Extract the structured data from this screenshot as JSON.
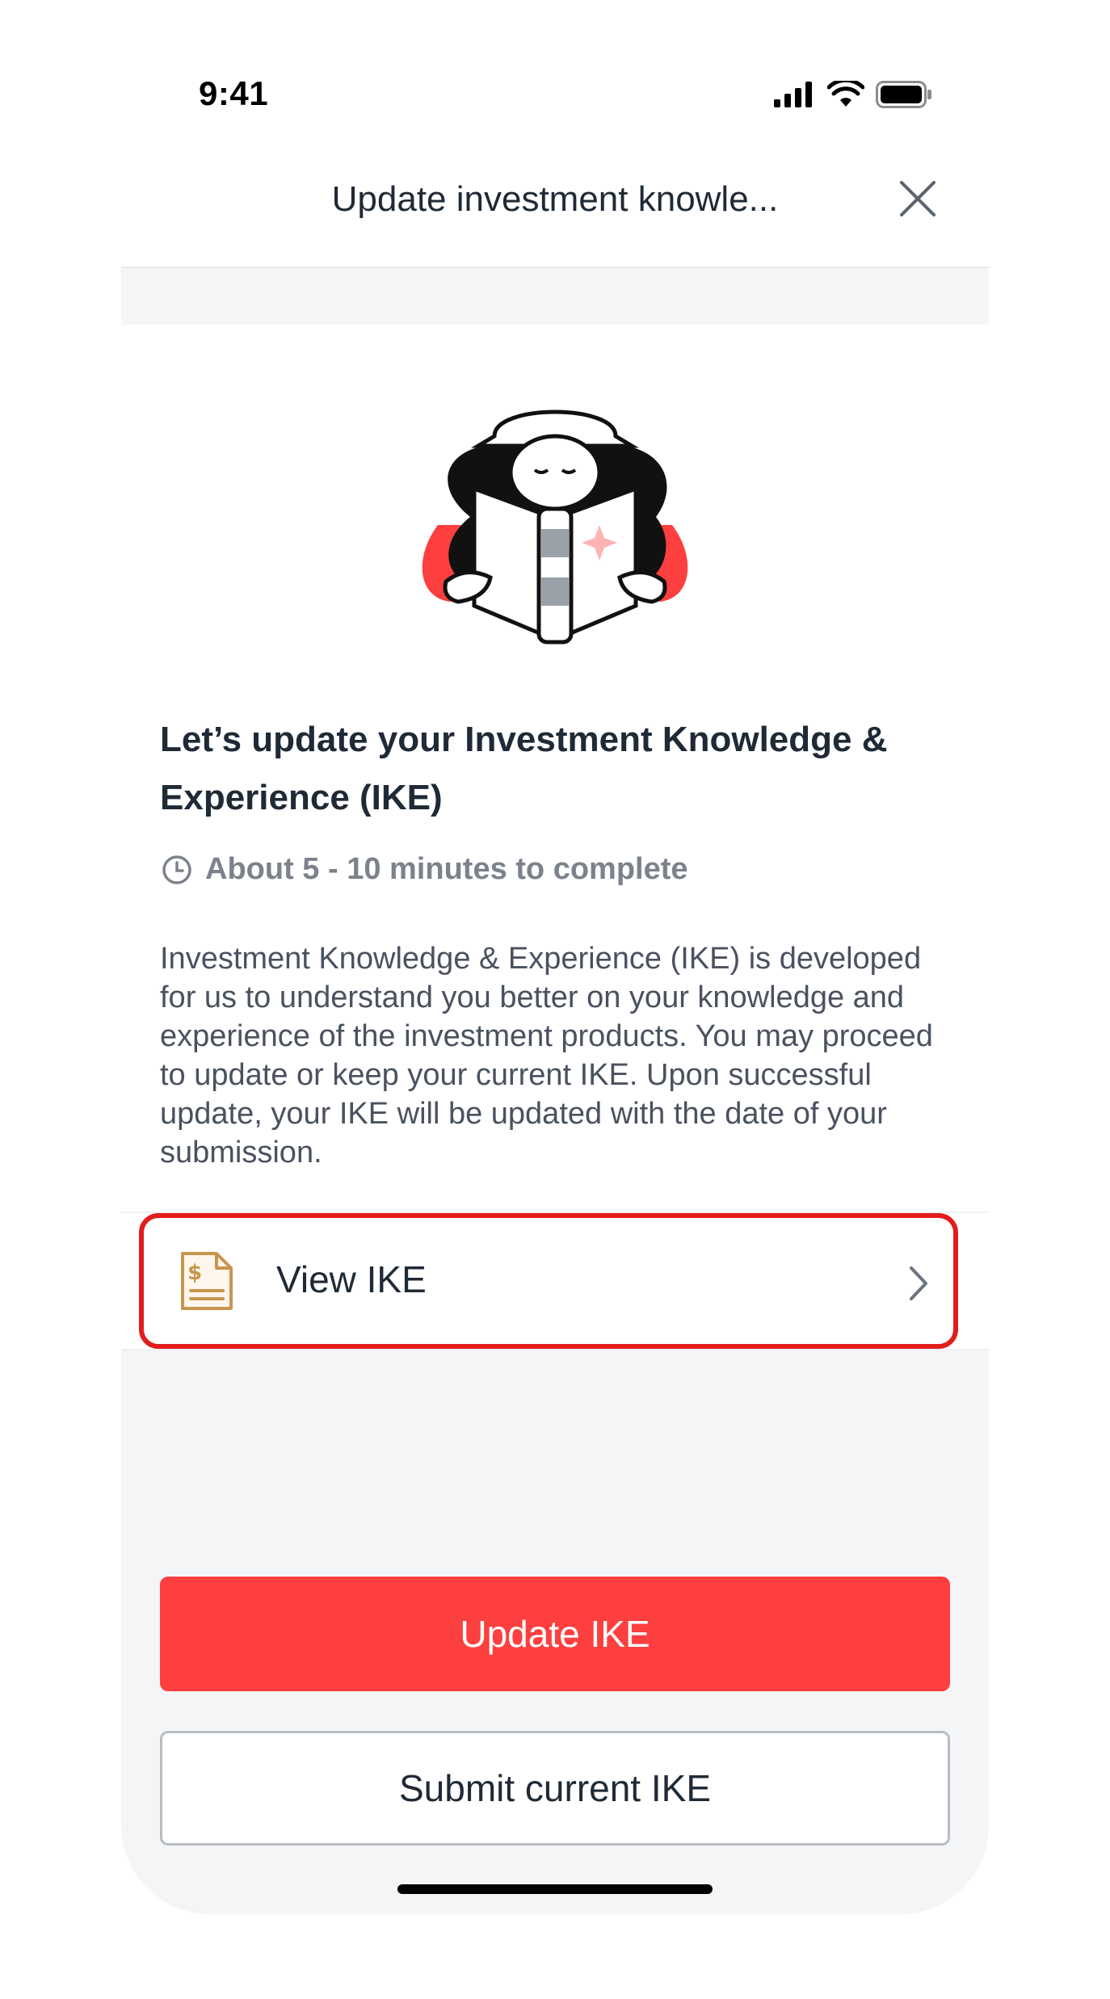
{
  "status_bar": {
    "time": "9:41"
  },
  "header": {
    "title": "Update investment knowle..."
  },
  "main": {
    "heading": "Let’s update your Investment Knowledge & Experience (IKE)",
    "duration": "About 5 - 10 minutes to complete",
    "description": "Investment Knowledge & Experience (IKE) is developed for us to understand you better on your knowledge and experience of the investment products. You may proceed to update or keep your current IKE. Upon successful update, your IKE will be updated with the date of your submission."
  },
  "view_ike": {
    "label": "View IKE"
  },
  "actions": {
    "primary_label": "Update IKE",
    "secondary_label": "Submit current IKE"
  },
  "colors": {
    "accent": "#fe3f3f",
    "highlight": "#e31c1c",
    "doc_icon": "#c8954d"
  }
}
